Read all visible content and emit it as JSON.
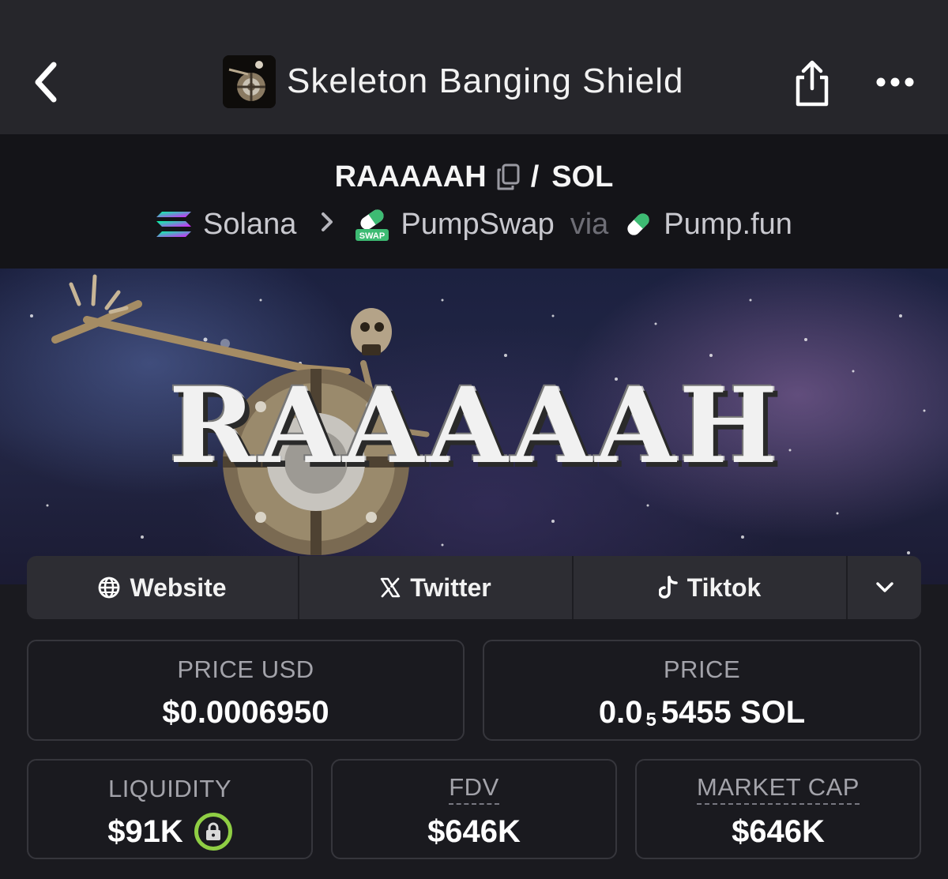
{
  "nav": {
    "title": "Skeleton Banging Shield",
    "back_icon": "chevron-left-icon",
    "share_icon": "share-icon",
    "more_icon": "more-dots-icon"
  },
  "pair": {
    "base": "RAAAAAH",
    "separator": "/",
    "quote": "SOL",
    "chain": "Solana",
    "dex": "PumpSwap",
    "via": "via",
    "launchpad": "Pump.fun"
  },
  "banner": {
    "text": "RAAAAAH"
  },
  "links": {
    "website": "Website",
    "twitter": "Twitter",
    "tiktok": "Tiktok",
    "swap_badge": "SWAP"
  },
  "stats": {
    "price_usd_label": "PRICE USD",
    "price_usd_value": "$0.0006950",
    "price_label": "PRICE",
    "price_prefix": "0.0",
    "price_subscript": "5",
    "price_suffix": "5455 SOL",
    "liquidity_label": "LIQUIDITY",
    "liquidity_value": "$91K",
    "fdv_label": "FDV",
    "fdv_value": "$646K",
    "mcap_label": "MARKET CAP",
    "mcap_value": "$646K"
  },
  "colors": {
    "background": "#1a1a1f",
    "topbar": "#26262b",
    "pair_header": "#141418",
    "lock_badge": "#8fce44",
    "pill_green": "#3dbb73"
  }
}
